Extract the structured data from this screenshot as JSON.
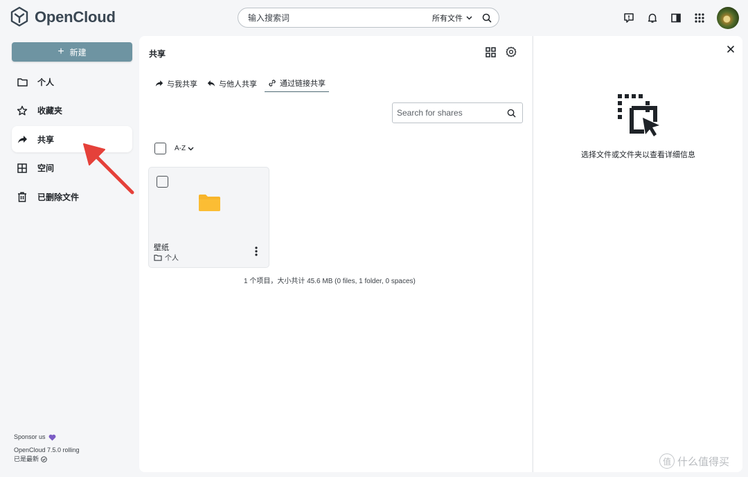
{
  "app": {
    "name": "OpenCloud"
  },
  "header": {
    "search_placeholder": "输入搜索词",
    "search_scope": "所有文件",
    "icons": [
      "feedback-icon",
      "bell-icon",
      "sidebar-toggle-icon",
      "apps-grid-icon",
      "user-avatar"
    ]
  },
  "sidebar": {
    "new_button_label": "新建",
    "items": [
      {
        "label": "个人",
        "icon": "folder-icon",
        "active": false
      },
      {
        "label": "收藏夹",
        "icon": "star-icon",
        "active": false
      },
      {
        "label": "共享",
        "icon": "share-arrow-icon",
        "active": true
      },
      {
        "label": "空间",
        "icon": "spaces-grid-icon",
        "active": false
      },
      {
        "label": "已删除文件",
        "icon": "trash-icon",
        "active": false
      }
    ],
    "footer": {
      "sponsor": "Sponsor us",
      "version": "OpenCloud 7.5.0 rolling",
      "update_status": "已是最新"
    }
  },
  "main": {
    "title": "共享",
    "tabs": [
      {
        "label": "与我共享",
        "icon": "share-arrow-icon",
        "active": false
      },
      {
        "label": "与他人共享",
        "icon": "reply-arrow-icon",
        "active": false
      },
      {
        "label": "通过链接共享",
        "icon": "link-icon",
        "active": true
      }
    ],
    "search_placeholder": "Search for shares",
    "sort_label": "A-Z",
    "items": [
      {
        "name": "壁纸",
        "location": "个人",
        "type": "folder"
      }
    ],
    "summary": "1 个项目，大小共计 45.6 MB (0 files, 1 folder, 0 spaces)"
  },
  "details": {
    "hint": "选择文件或文件夹以查看详细信息"
  },
  "watermark": {
    "badge": "值",
    "text": "什么值得买"
  },
  "colors": {
    "new_button": "#6e94a2",
    "folder": "#f8b52a",
    "annotation_arrow": "#e5413a",
    "sponsor_heart": "#7b5cc4",
    "background": "#f5f6f8"
  }
}
